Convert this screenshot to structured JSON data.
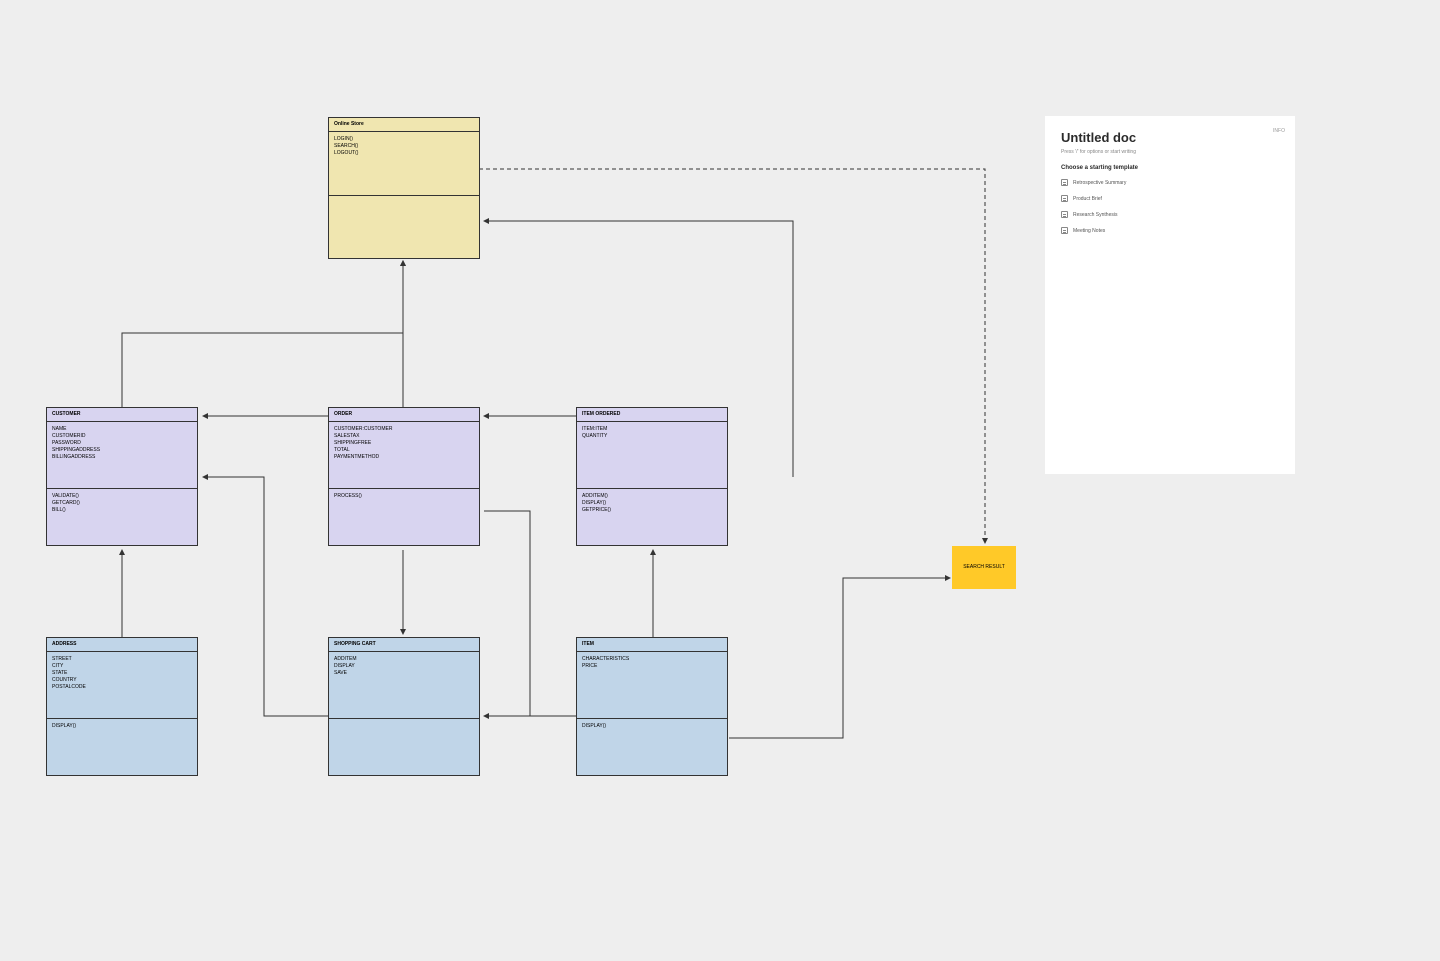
{
  "boxes": {
    "onlineStore": {
      "title": "Online Store",
      "attrs": [
        "LOGIN()",
        "SEARCH()",
        "LOGOUT()"
      ]
    },
    "customer": {
      "title": "CUSTOMER",
      "attrs": [
        "NAME",
        "CUSTOMERID",
        "PASSWORD",
        "SHIPPINGADDRESS",
        "BILLINGADDRESS"
      ],
      "ops": [
        "VALIDATE()",
        "GETCARD()",
        "BILL()"
      ]
    },
    "order": {
      "title": "ORDER",
      "attrs": [
        "CUSTOMER:CUSTOMER",
        "SALESTAX",
        "SHIPPINGFREE",
        "TOTAL",
        "PAYMENTMETHOD"
      ],
      "ops": [
        "PROCESS()"
      ]
    },
    "itemOrdered": {
      "title": "ITEM ORDERED",
      "attrs": [
        "ITEM:ITEM",
        "QUANTITY"
      ],
      "ops": [
        "ADDITEM()",
        "DISPLAY()",
        "GETPRICE()"
      ]
    },
    "address": {
      "title": "ADDRESS",
      "attrs": [
        "STREET",
        "CITY",
        "STATE",
        "COUNTRY",
        "POSTALCODE"
      ],
      "ops": [
        "DISPLAY()"
      ]
    },
    "shoppingCart": {
      "title": "SHOPPING CART",
      "attrs": [
        "ADDITEM",
        "DISPLAY",
        "SAVE"
      ]
    },
    "item": {
      "title": "ITEM",
      "attrs": [
        "CHARACTERISTICS",
        "PRICE"
      ],
      "ops": [
        "DISPLAY()"
      ]
    },
    "searchResult": {
      "title": "SEARCH RESULT"
    }
  },
  "docPanel": {
    "info": "INFO",
    "title": "Untitled doc",
    "hint": "Press '/' for options or start writing",
    "choose": "Choose a starting template",
    "templates": [
      "Retrospective Summary",
      "Product Brief",
      "Research Synthesis",
      "Meeting Notes"
    ]
  }
}
